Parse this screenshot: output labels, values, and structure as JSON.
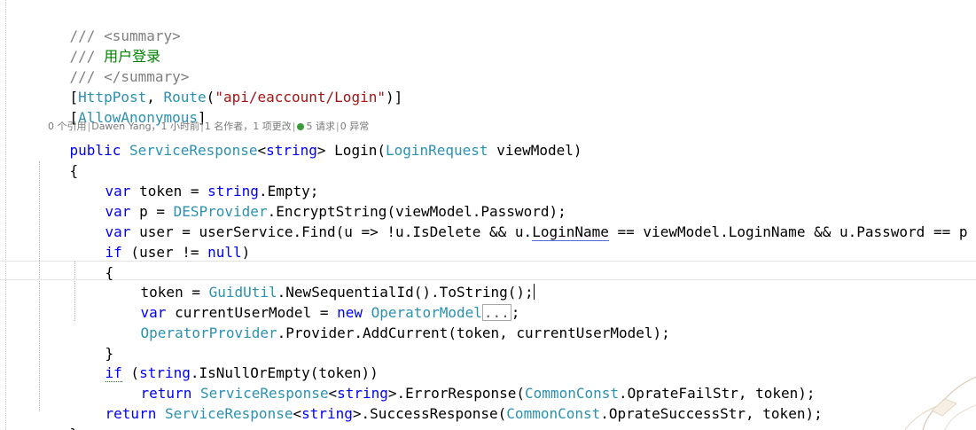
{
  "lines": {
    "l1": "/// <summary>",
    "l2_prefix": "/// ",
    "l2_text": "用户登录",
    "l3": "/// </summary>",
    "l4_open": "[",
    "l4_attr1": "HttpPost",
    "l4_comma": ", ",
    "l4_attr2": "Route",
    "l4_paren": "(",
    "l4_str": "\"api/eaccount/Login\"",
    "l4_close": ")]",
    "l5_open": "[",
    "l5_attr": "AllowAnonymous",
    "l5_close": "]",
    "l7_public": "public",
    "l7_type1": "ServiceResponse",
    "l7_lt": "<",
    "l7_string": "string",
    "l7_gt": "> Login(",
    "l7_type2": "LoginRequest",
    "l7_rest": " viewModel)",
    "l8": "{",
    "l9_var": "var",
    "l9_mid": " token = ",
    "l9_string": "string",
    "l9_rest": ".Empty;",
    "l10_var": "var",
    "l10_mid": " p = ",
    "l10_type": "DESProvider",
    "l10_rest": ".EncryptString(viewModel.Password);",
    "l11_var": "var",
    "l11_a": " user = userService.Find(u => !u.IsDelete && u.",
    "l11_login": "LoginName",
    "l11_b": " == viewModel.LoginName && u.Password == p",
    "l12_if": "if",
    "l12_a": " (user != ",
    "l12_null": "null",
    "l12_b": ")",
    "l13": "{",
    "l14_a": "token = ",
    "l14_type": "GuidUtil",
    "l14_b": ".NewSequentialId().ToString();",
    "l15_var": "var",
    "l15_a": " currentUserModel = ",
    "l15_new": "new",
    "l15_sp": " ",
    "l15_type": "OperatorModel",
    "l15_collapsed": "...",
    "l15_end": ";",
    "l16_type": "OperatorProvider",
    "l16_rest": ".Provider.AddCurrent(token, currentUserModel);",
    "l17": "}",
    "l18_if": "if",
    "l18_a": " (",
    "l18_string": "string",
    "l18_b": ".IsNullOrEmpty(token))",
    "l19_return": "return",
    "l19_sp": " ",
    "l19_type": "ServiceResponse",
    "l19_lt": "<",
    "l19_string": "string",
    "l19_a": ">.ErrorResponse(",
    "l19_type2": "CommonConst",
    "l19_b": ".OprateFailStr, token);",
    "l20_return": "return",
    "l20_sp": " ",
    "l20_type": "ServiceResponse",
    "l20_lt": "<",
    "l20_string": "string",
    "l20_a": ">.SuccessResponse(",
    "l20_type2": "CommonConst",
    "l20_b": ".OprateSuccessStr, token);",
    "l21": "}"
  },
  "codelens": {
    "references": "0 个引用",
    "author": "Dawen Yang，1 小时前",
    "changes": "1 名作者，1 项更改",
    "requests": "5 请求",
    "exceptions": "0 异常",
    "separator": "|"
  },
  "colors": {
    "comment": "#7f7f7f",
    "doc_text": "#008000",
    "keyword": "#0000ff",
    "type": "#2b91af",
    "string": "#a31515"
  }
}
